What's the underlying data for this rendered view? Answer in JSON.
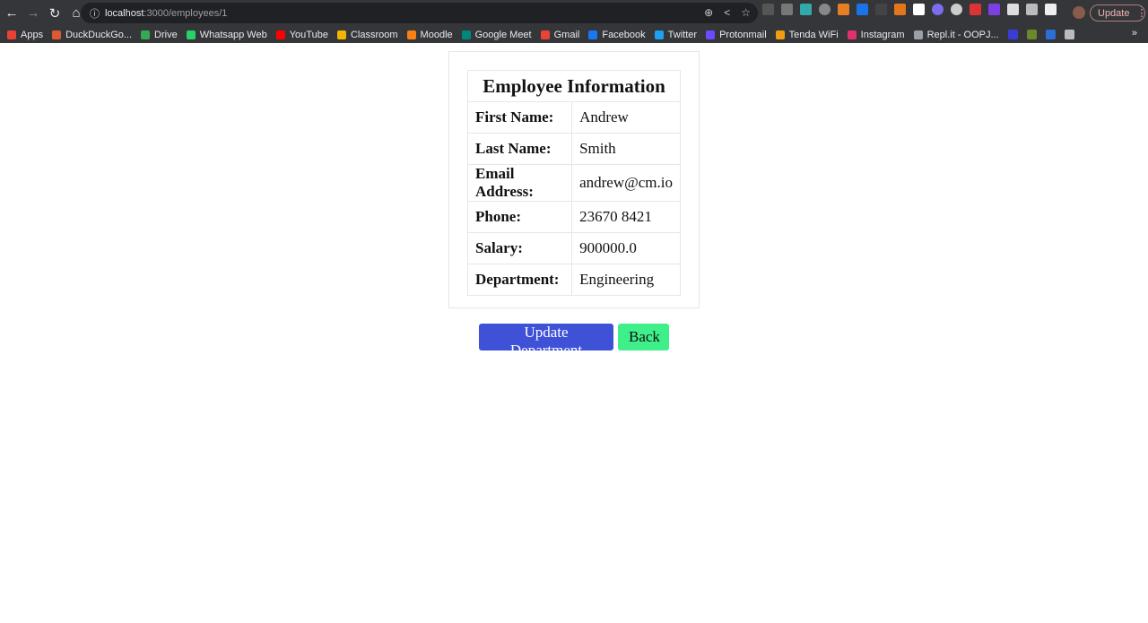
{
  "browser": {
    "url_host": "localhost",
    "url_path": ":3000/employees/1",
    "update_label": "Update",
    "bookmarks": [
      {
        "label": "Apps",
        "color": "#e94235"
      },
      {
        "label": "DuckDuckGo...",
        "color": "#de5833"
      },
      {
        "label": "Drive",
        "color": "#34a853"
      },
      {
        "label": "Whatsapp Web",
        "color": "#25d366"
      },
      {
        "label": "YouTube",
        "color": "#ff0000"
      },
      {
        "label": "Classroom",
        "color": "#f4b400"
      },
      {
        "label": "Moodle",
        "color": "#f98012"
      },
      {
        "label": "Google Meet",
        "color": "#00897b"
      },
      {
        "label": "Gmail",
        "color": "#ea4335"
      },
      {
        "label": "Facebook",
        "color": "#1877f2"
      },
      {
        "label": "Twitter",
        "color": "#1da1f2"
      },
      {
        "label": "Protonmail",
        "color": "#6d4aff"
      },
      {
        "label": "Tenda WiFi",
        "color": "#f39c12"
      },
      {
        "label": "Instagram",
        "color": "#e1306c"
      },
      {
        "label": "Repl.it - OOPJ...",
        "color": "#9aa0a6"
      }
    ]
  },
  "employee": {
    "title": "Employee Information",
    "rows": [
      {
        "label": "First Name:",
        "value": "Andrew"
      },
      {
        "label": "Last Name:",
        "value": "Smith"
      },
      {
        "label": "Email Address:",
        "value": "andrew@cm.io"
      },
      {
        "label": "Phone:",
        "value": "23670 8421"
      },
      {
        "label": "Salary:",
        "value": "900000.0"
      },
      {
        "label": "Department:",
        "value": "Engineering"
      }
    ]
  },
  "actions": {
    "update_department": "Update Department",
    "back": "Back"
  },
  "colors": {
    "primary": "#3f51d6",
    "back": "#3ff08a"
  }
}
